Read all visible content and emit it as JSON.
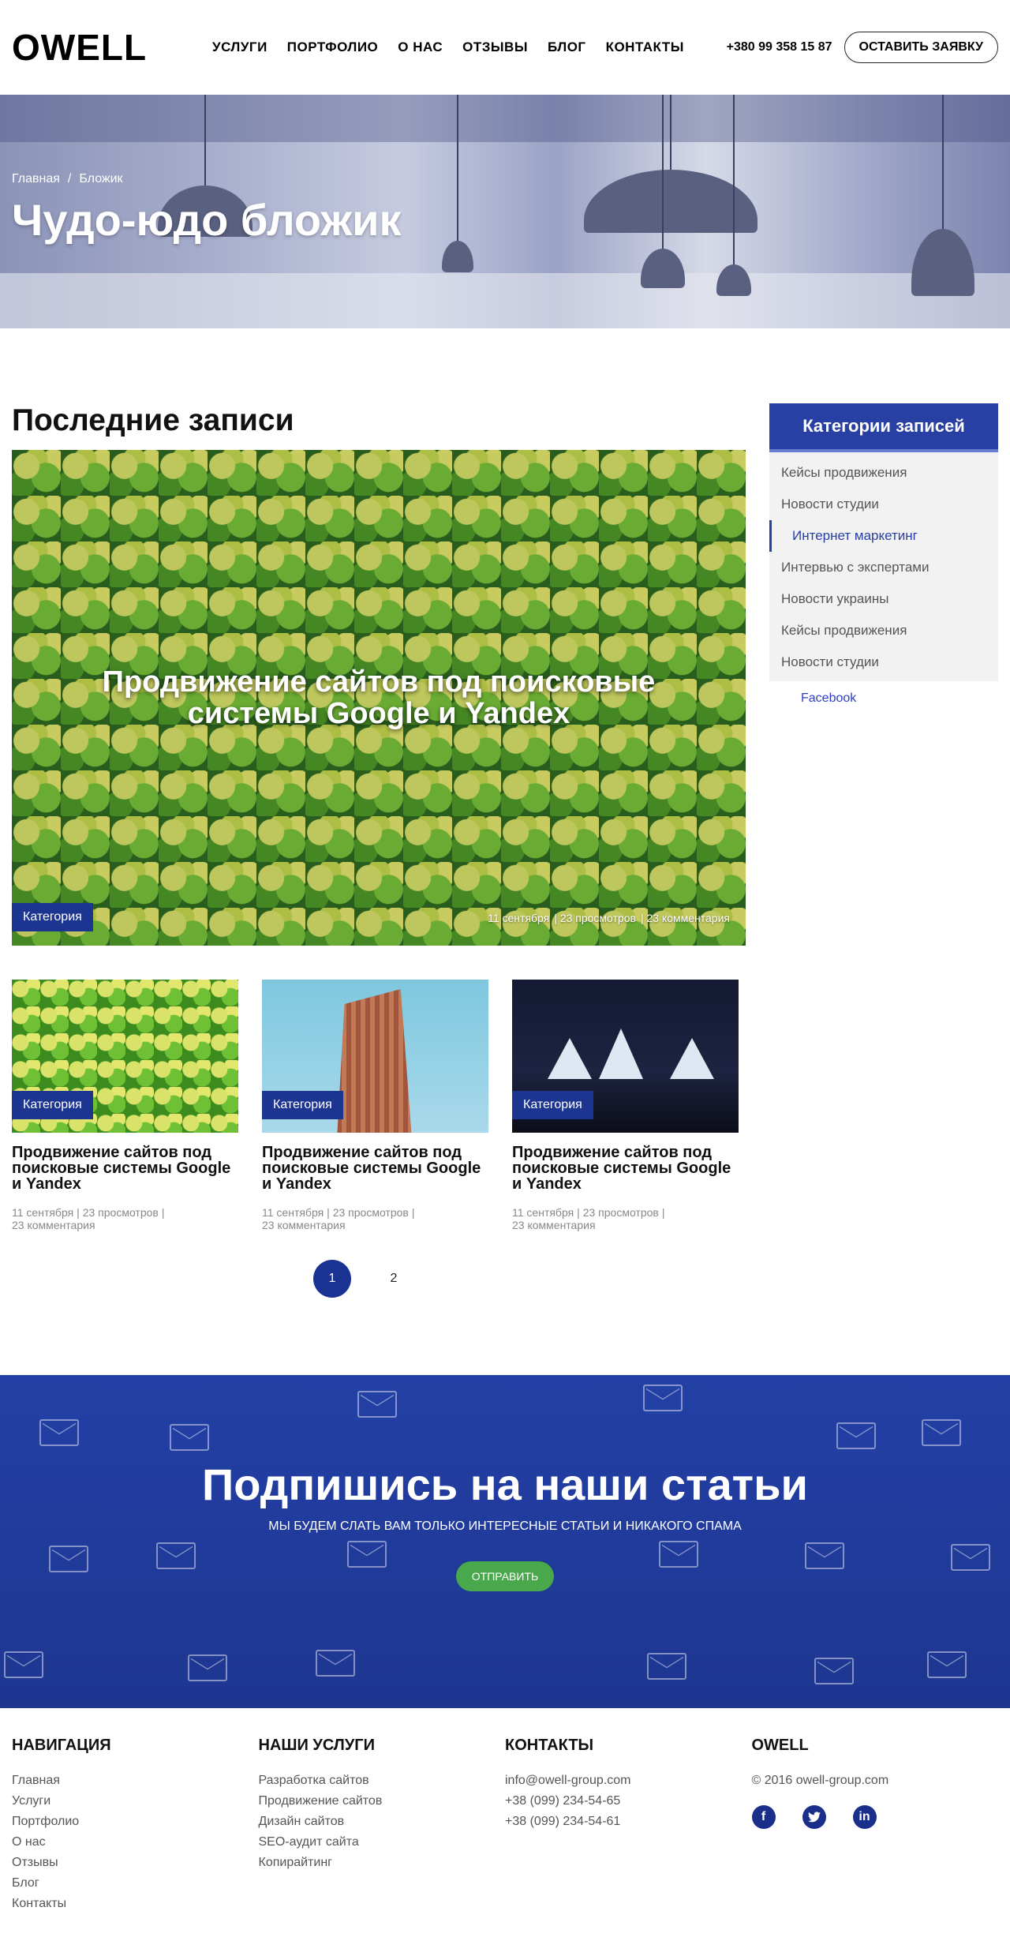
{
  "header": {
    "logo": "OWELL",
    "nav": [
      "УСЛУГИ",
      "ПОРТФОЛИО",
      "О НАС",
      "ОТЗЫВЫ",
      "БЛОГ",
      "КОНТАКТЫ"
    ],
    "phone": "+380 99 358 15 87",
    "cta": "ОСТАВИТЬ ЗАЯВКУ"
  },
  "hero": {
    "breadcrumb": [
      "Главная",
      "/",
      "Бложик"
    ],
    "title": "Чудо-юдо бложик"
  },
  "main": {
    "section_title": "Последние записи",
    "featured": {
      "title_line1": "Продвижение сайтов под поисковые",
      "title_line2": "системы Google и Yandex",
      "category": "Категория",
      "date": "11 сентября",
      "views": "| 23 просмотров",
      "comments": "| 23 комментария"
    },
    "cards": [
      {
        "category": "Категория",
        "title": "Продвижение сайтов под поисковые системы Google и Yandex",
        "date": "11 сентября",
        "views": "| 23 просмотров",
        "sep": "|",
        "comments": "23 комментария"
      },
      {
        "category": "Категория",
        "title": "Продвижение сайтов под поисковые системы Google и Yandex",
        "date": "11 сентября",
        "views": "| 23 просмотров",
        "sep": "|",
        "comments": "23 комментария"
      },
      {
        "category": "Категория",
        "title": "Продвижение сайтов под поисковые системы Google и Yandex",
        "date": "11 сентября",
        "views": "| 23 просмотров",
        "sep": "|",
        "comments": "23 комментария"
      }
    ],
    "pagination": [
      "1",
      "2"
    ],
    "current_page": 1
  },
  "sidebar": {
    "title": "Категории записей",
    "items": [
      "Кейсы продвижения",
      "Новости студии",
      "Интернет маркетинг",
      "Интервью с экспертами",
      "Новости украины",
      "Кейсы продвижения",
      "Новости студии"
    ],
    "active_index": 2,
    "facebook": "Facebook"
  },
  "subscribe": {
    "title": "Подпишись на наши статьи",
    "text": "МЫ БУДЕМ СЛАТЬ ВАМ ТОЛЬКО ИНТЕРЕСНЫЕ СТАТЬИ И НИКАКОГО СПАМА",
    "button": "ОТПРАВИТЬ"
  },
  "footer": {
    "nav": {
      "title": "НАВИГАЦИЯ",
      "links": [
        "Главная",
        "Услуги",
        "Портфолио",
        "О нас",
        "Отзывы",
        "Блог",
        "Контакты"
      ]
    },
    "services": {
      "title": "НАШИ УСЛУГИ",
      "links": [
        "Разработка сайтов",
        "Продвижение сайтов",
        "Дизайн сайтов",
        "SEO-аудит сайта",
        "Копирайтинг"
      ]
    },
    "contacts": {
      "title": "КОНТАКТЫ",
      "links": [
        "info@owell-group.com",
        "+38 (099) 234-54-65",
        "+38 (099) 234-54-61"
      ]
    },
    "brand": {
      "title": "OWELL",
      "copyright": "© 2016 owell-group.com",
      "socials": [
        "f",
        "t",
        "in"
      ]
    }
  },
  "colors": {
    "brand_blue": "#1c3590",
    "accent_green": "#4aa84c",
    "sidebar_blue": "#2840a3"
  }
}
